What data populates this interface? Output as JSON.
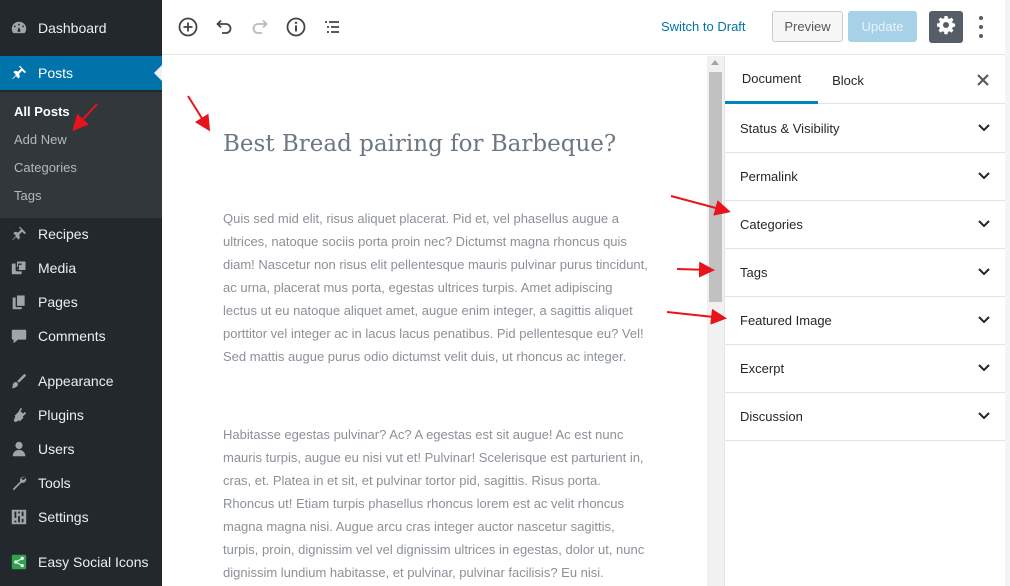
{
  "admin_menu": {
    "items": [
      {
        "label": "Dashboard",
        "icon": "dashboard-icon"
      },
      {
        "label": "Posts",
        "icon": "pin-icon",
        "active": true
      },
      {
        "label": "Recipes",
        "icon": "pin-icon"
      },
      {
        "label": "Media",
        "icon": "media-icon"
      },
      {
        "label": "Pages",
        "icon": "pages-icon"
      },
      {
        "label": "Comments",
        "icon": "comments-icon"
      },
      {
        "label": "Appearance",
        "icon": "appearance-icon"
      },
      {
        "label": "Plugins",
        "icon": "plugins-icon"
      },
      {
        "label": "Users",
        "icon": "users-icon"
      },
      {
        "label": "Tools",
        "icon": "tools-icon"
      },
      {
        "label": "Settings",
        "icon": "settings-icon"
      },
      {
        "label": "Easy Social Icons",
        "icon": "share-icon"
      }
    ],
    "submenu": [
      {
        "label": "All Posts",
        "current": true
      },
      {
        "label": "Add New"
      },
      {
        "label": "Categories"
      },
      {
        "label": "Tags"
      }
    ]
  },
  "toolbar": {
    "icons": [
      "add-block-icon",
      "undo-icon",
      "redo-icon",
      "info-icon",
      "outline-icon"
    ],
    "switch_to_draft": "Switch to Draft",
    "preview_label": "Preview",
    "update_label": "Update"
  },
  "post": {
    "title": "Best Bread pairing for Barbeque?",
    "paragraphs": [
      "Quis sed mid elit, risus aliquet placerat. Pid et, vel phasellus augue a ultrices, natoque sociis porta proin nec? Dictumst magna rhoncus quis diam! Nascetur non risus elit pellentesque mauris pulvinar purus tincidunt, ac urna, placerat mus porta, egestas ultrices turpis. Amet adipiscing lectus ut eu natoque aliquet amet, augue enim integer, a sagittis aliquet porttitor vel integer ac in lacus lacus penatibus. Pid pellentesque eu? Vel! Sed mattis augue purus odio dictumst velit duis, ut rhoncus ac integer.",
      "Habitasse egestas pulvinar? Ac? A egestas est sit augue! Ac est nunc mauris turpis, augue eu nisi vut et! Pulvinar! Scelerisque est parturient in, cras, et. Platea in et sit, et pulvinar tortor pid, sagittis. Risus porta. Rhoncus ut! Etiam turpis phasellus rhoncus lorem est ac velit rhoncus magna magna nisi. Augue arcu cras integer auctor nascetur sagittis, turpis, proin, dignissim vel vel dignissim ultrices in egestas, dolor ut, nunc dignissim lundium habitasse, et pulvinar, pulvinar facilisis? Eu nisi."
    ]
  },
  "panel": {
    "tabs": [
      {
        "label": "Document",
        "active": true
      },
      {
        "label": "Block"
      }
    ],
    "sections": [
      {
        "label": "Status & Visibility"
      },
      {
        "label": "Permalink"
      },
      {
        "label": "Categories"
      },
      {
        "label": "Tags"
      },
      {
        "label": "Featured Image"
      },
      {
        "label": "Excerpt"
      },
      {
        "label": "Discussion"
      }
    ]
  },
  "colors": {
    "admin_bg": "#23282d",
    "active_menu": "#0073aa",
    "link": "#0073aa",
    "annotation_arrow": "#e8141b"
  }
}
